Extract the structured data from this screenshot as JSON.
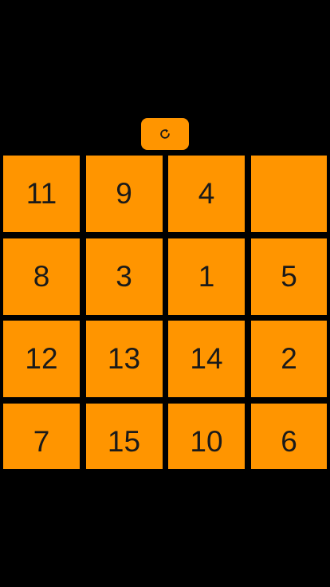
{
  "colors": {
    "background": "#000000",
    "tile": "#FF9500",
    "tile_text": "#1a1a1a",
    "button": "#FF9500",
    "icon": "#1a1a1a"
  },
  "reset_button": {
    "icon": "refresh-icon"
  },
  "board": {
    "rows": 4,
    "cols": 4,
    "tiles": [
      [
        "11",
        "9",
        "4",
        ""
      ],
      [
        "8",
        "3",
        "1",
        "5"
      ],
      [
        "12",
        "13",
        "14",
        "2"
      ],
      [
        "7",
        "15",
        "10",
        "6"
      ]
    ]
  }
}
